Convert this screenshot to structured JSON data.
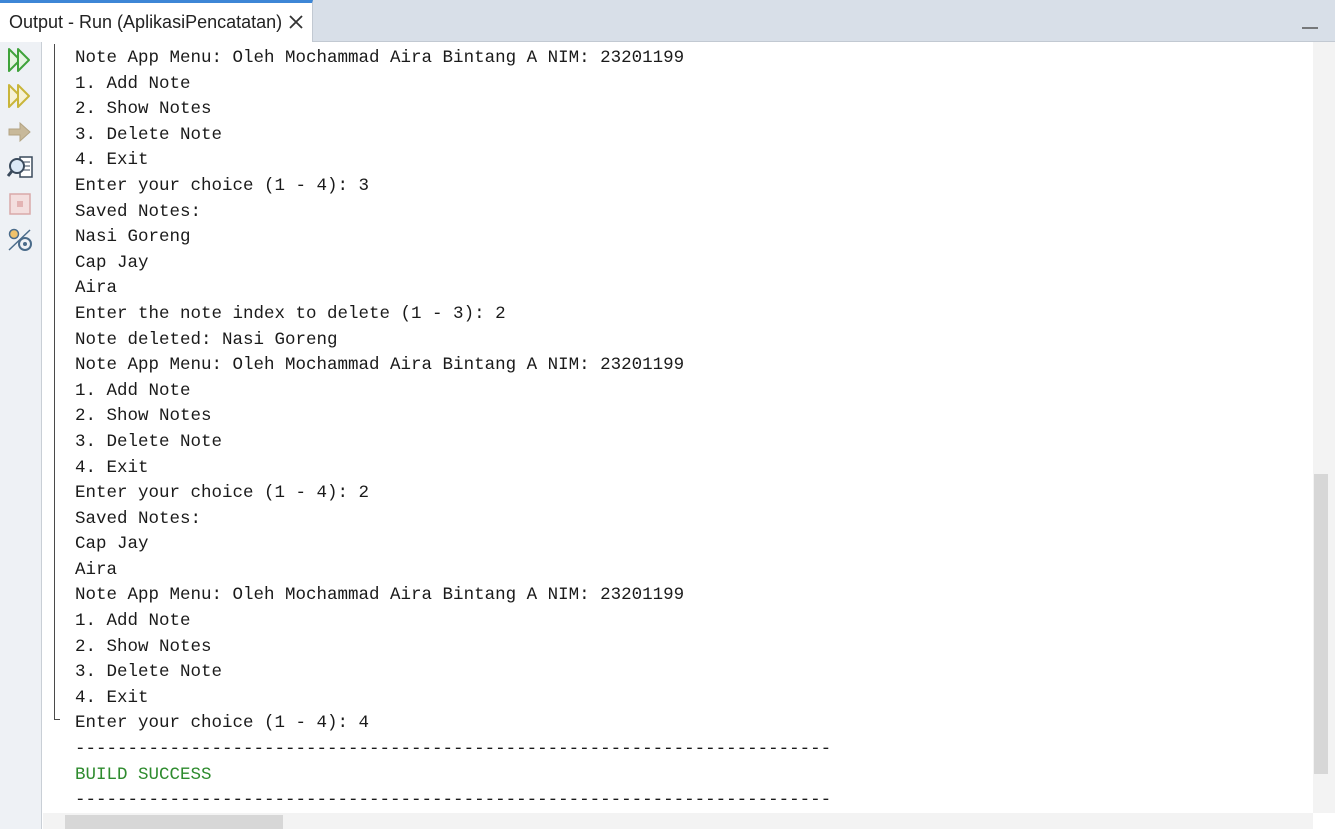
{
  "tab": {
    "title": "Output - Run (AplikasiPencatatan)",
    "close_symbol": "✕"
  },
  "toolbar": {
    "buttons": [
      {
        "name": "rerun-icon",
        "color": "#3fa33b"
      },
      {
        "name": "rerun-with-options-icon",
        "color": "#c9b53a"
      },
      {
        "name": "continue-arrow-icon",
        "color": "#c8b99a"
      },
      {
        "name": "find-in-output-icon",
        "color": "#3a4a5c"
      },
      {
        "name": "stop-icon",
        "color": "#e3b3b3"
      },
      {
        "name": "output-settings-icon",
        "color": "#4a6b8a"
      }
    ]
  },
  "console": {
    "lines": [
      "Note App Menu: Oleh Mochammad Aira Bintang A NIM: 23201199",
      "1. Add Note",
      "2. Show Notes",
      "3. Delete Note",
      "4. Exit",
      "Enter your choice (1 - 4): 3",
      "Saved Notes:",
      "Nasi Goreng",
      "Cap Jay",
      "Aira",
      "Enter the note index to delete (1 - 3): 2",
      "Note deleted: Nasi Goreng",
      "Note App Menu: Oleh Mochammad Aira Bintang A NIM: 23201199",
      "1. Add Note",
      "2. Show Notes",
      "3. Delete Note",
      "4. Exit",
      "Enter your choice (1 - 4): 2",
      "Saved Notes:",
      "Cap Jay",
      "Aira",
      "Note App Menu: Oleh Mochammad Aira Bintang A NIM: 23201199",
      "1. Add Note",
      "2. Show Notes",
      "3. Delete Note",
      "4. Exit",
      "Enter your choice (1 - 4): 4"
    ],
    "separator_top": "------------------------------------------------------------------------",
    "build_status": "BUILD SUCCESS",
    "separator_bottom": "------------------------------------------------------------------------"
  },
  "colors": {
    "accent": "#3d86d6",
    "success": "#2e8b2e",
    "text": "#1a1a1a"
  }
}
